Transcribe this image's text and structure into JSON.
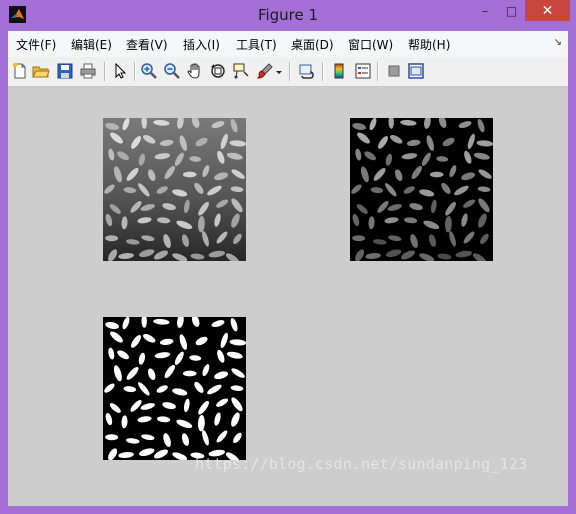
{
  "window": {
    "title": "Figure 1",
    "controls": {
      "minimize": "–",
      "maximize": "□",
      "close": "✕"
    }
  },
  "menubar": {
    "items": [
      {
        "label": "文件(F)",
        "name": "menu-file"
      },
      {
        "label": "编辑(E)",
        "name": "menu-edit"
      },
      {
        "label": "查看(V)",
        "name": "menu-view"
      },
      {
        "label": "插入(I)",
        "name": "menu-insert"
      },
      {
        "label": "工具(T)",
        "name": "menu-tools"
      },
      {
        "label": "桌面(D)",
        "name": "menu-desktop"
      },
      {
        "label": "窗口(W)",
        "name": "menu-window"
      },
      {
        "label": "帮助(H)",
        "name": "menu-help"
      }
    ],
    "dock_arrow": "↘"
  },
  "toolbar": {
    "buttons": [
      {
        "icon": "new-figure-icon"
      },
      {
        "icon": "open-file-icon"
      },
      {
        "icon": "save-figure-icon"
      },
      {
        "icon": "print-figure-icon"
      },
      {
        "icon": "edit-plot-arrow-icon"
      },
      {
        "icon": "zoom-in-icon"
      },
      {
        "icon": "zoom-out-icon"
      },
      {
        "icon": "pan-hand-icon"
      },
      {
        "icon": "rotate-3d-icon"
      },
      {
        "icon": "data-cursor-icon"
      },
      {
        "icon": "brush-icon"
      },
      {
        "icon": "brush-dropdown-icon"
      },
      {
        "icon": "link-plot-icon"
      },
      {
        "icon": "colorbar-icon"
      },
      {
        "icon": "legend-icon"
      },
      {
        "icon": "hide-plot-tools-icon"
      },
      {
        "icon": "show-plot-tools-icon"
      }
    ]
  },
  "axes": [
    {
      "name": "original-image",
      "kind": "grayscale-uneven-background"
    },
    {
      "name": "background-subtracted-image",
      "kind": "grayscale-dark-background"
    },
    {
      "name": "binary-image",
      "kind": "binary"
    }
  ],
  "watermark": "https://blog.csdn.net/sundanping_123",
  "colors": {
    "window_border": "#a46fd6",
    "figure_background": "#cdcdcd",
    "close_button": "#c7463e"
  }
}
